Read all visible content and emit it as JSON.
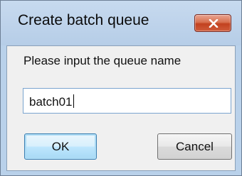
{
  "dialog": {
    "title": "Create batch queue",
    "close_icon": "close-x-icon",
    "prompt": "Please input the queue name",
    "input_value": "batch01",
    "ok_label": "OK",
    "cancel_label": "Cancel"
  },
  "colors": {
    "frame": "#b9d1ea",
    "client": "#f0f0f0",
    "close_button": "#c2421f",
    "focus_border": "#3c7fb1"
  }
}
